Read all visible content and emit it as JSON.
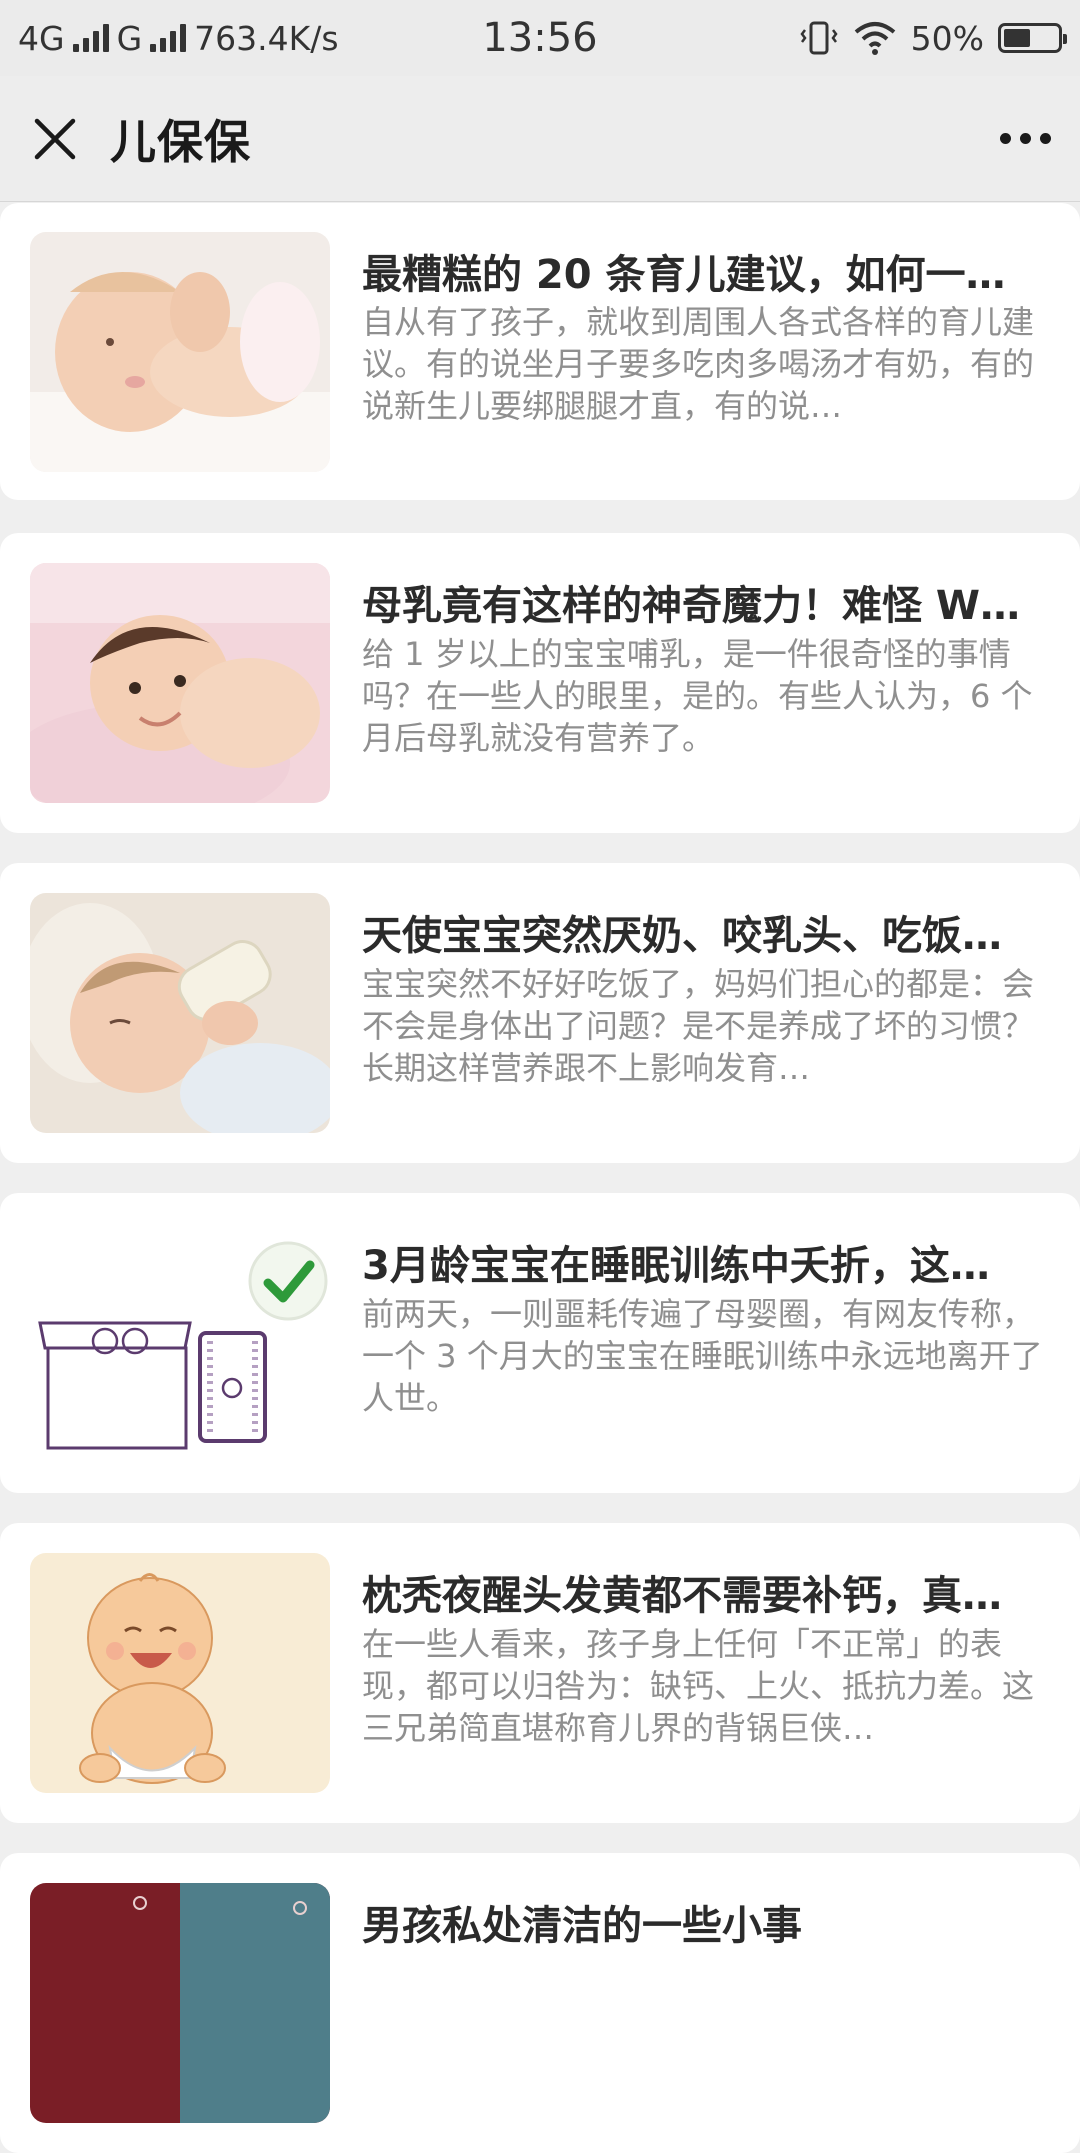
{
  "status_bar": {
    "network1": "4G",
    "network2": "G",
    "speed": "763.4K/s",
    "time": "13:56",
    "battery": "50%",
    "battery_level": 0.5
  },
  "header": {
    "title": "儿保保"
  },
  "articles": [
    {
      "title": "最糟糕的 20 条育儿建议，如何一…",
      "excerpt": "自从有了孩子，就收到周围人各式各样的育儿建议。有的说坐月子要多吃肉多喝汤才有奶，有的说新生儿要绑腿腿才直，有的说…",
      "thumb": "baby-lying-feet-image"
    },
    {
      "title": "母乳竟有这样的神奇魔力！难怪 W…",
      "excerpt": "给 1 岁以上的宝宝哺乳，是一件很奇怪的事情吗？在一些人的眼里，是的。有些人认为，6 个月后母乳就没有营养了。",
      "thumb": "baby-smiling-image"
    },
    {
      "title": "天使宝宝突然厌奶、咬乳头、吃饭…",
      "excerpt": "宝宝突然不好好吃饭了，妈妈们担心的都是：会不会是身体出了问题？是不是养成了坏的习惯？长期这样营养跟不上影响发育…",
      "thumb": "baby-bottle-image"
    },
    {
      "title": "3月龄宝宝在睡眠训练中夭折，这…",
      "excerpt": "前两天，一则噩耗传遍了母婴圈，有网友传称，一个 3 个月大的宝宝在睡眠训练中永远地离开了人世。",
      "thumb": "bed-crib-illustration"
    },
    {
      "title": "枕秃夜醒头发黄都不需要补钙，真…",
      "excerpt": "在一些人看来，孩子身上任何「不正常」的表现，都可以归咎为：缺钙、上火、抵抗力差。这三兄弟简直堪称育儿界的背锅巨侠…",
      "thumb": "cartoon-baby-illustration"
    },
    {
      "title": "男孩私处清洁的一些小事",
      "excerpt": "",
      "thumb": "baby-clothes-image"
    }
  ]
}
